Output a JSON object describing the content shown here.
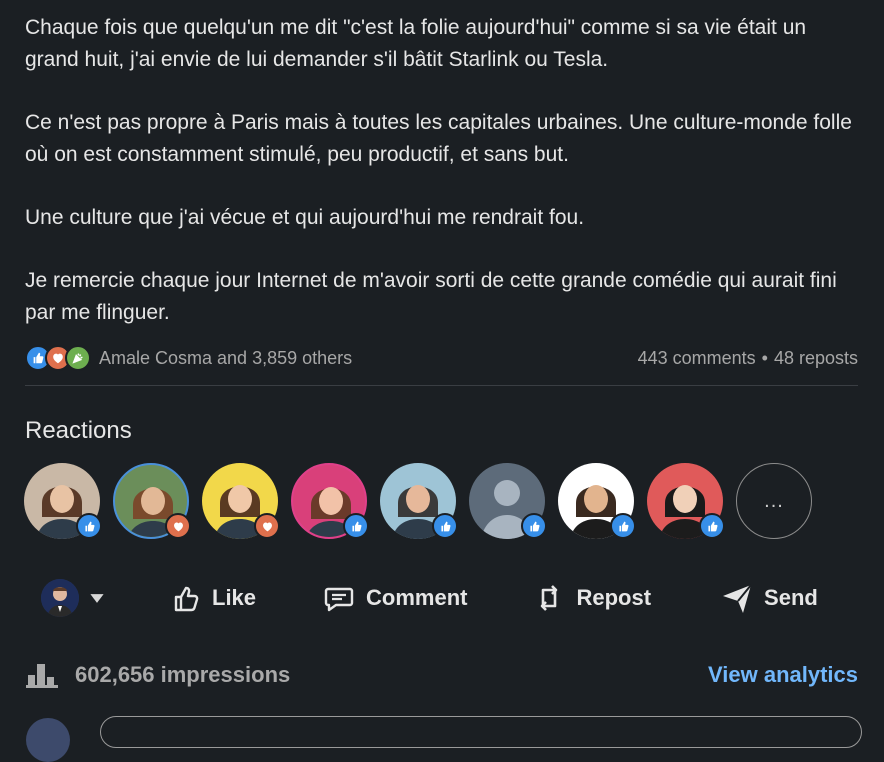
{
  "post": {
    "paragraphs": [
      "Chaque fois que quelqu'un me dit \"c'est la folie aujourd'hui\" comme si sa vie était un grand huit, j'ai envie de lui demander s'il bâtit Starlink ou Tesla.",
      "Ce n'est pas propre à Paris mais à toutes les capitales urbaines. Une culture-monde folle où on est constamment stimulé, peu productif, et sans but.",
      "Une culture que j'ai vécue et qui aujourd'hui me rendrait fou.",
      "Je remercie chaque jour Internet de m'avoir sorti de cette grande comédie qui aurait fini par me flinguer."
    ]
  },
  "social_counts": {
    "reaction_icons": [
      "like-icon",
      "love-icon",
      "celebrate-icon"
    ],
    "reactors_text": "Amale Cosma and 3,859 others",
    "comments": "443 comments",
    "separator": "•",
    "reposts": "48 reposts"
  },
  "reactions": {
    "heading": "Reactions",
    "avatars": [
      {
        "reaction": "like",
        "bg": "#c9b8a6",
        "hair": "#5a3a28",
        "skin": "#e8c3a4"
      },
      {
        "reaction": "love",
        "bg": "#6b8e5a",
        "hair": "#7a4a2c",
        "skin": "#e2b896"
      },
      {
        "reaction": "love",
        "bg": "#f2d84a",
        "hair": "#5a3a22",
        "skin": "#f0c8a8"
      },
      {
        "reaction": "like",
        "bg": "#d9407a",
        "hair": "#6b3a2a",
        "skin": "#f2c2a8"
      },
      {
        "reaction": "like",
        "bg": "#9ec4d6",
        "hair": "#3a3a3a",
        "skin": "#e6b89a"
      },
      {
        "reaction": "like",
        "bg": "#5d6b7a",
        "hair": "#a8b4c0",
        "skin": "#a8b4c0"
      },
      {
        "reaction": "like",
        "bg": "#ffffff",
        "hair": "#3a2a20",
        "skin": "#e2b48e"
      },
      {
        "reaction": "like",
        "bg": "#e05a5a",
        "hair": "#1a1a1a",
        "skin": "#f0d0b8"
      }
    ],
    "more_label": "..."
  },
  "actions": {
    "like": "Like",
    "comment": "Comment",
    "repost": "Repost",
    "send": "Send"
  },
  "impressions": {
    "count_text": "602,656 impressions",
    "view_analytics": "View analytics"
  },
  "colors": {
    "background": "#1b1f23",
    "like": "#378fe9",
    "love": "#df704d",
    "celebrate": "#6dae4f",
    "link": "#71b7fb"
  }
}
